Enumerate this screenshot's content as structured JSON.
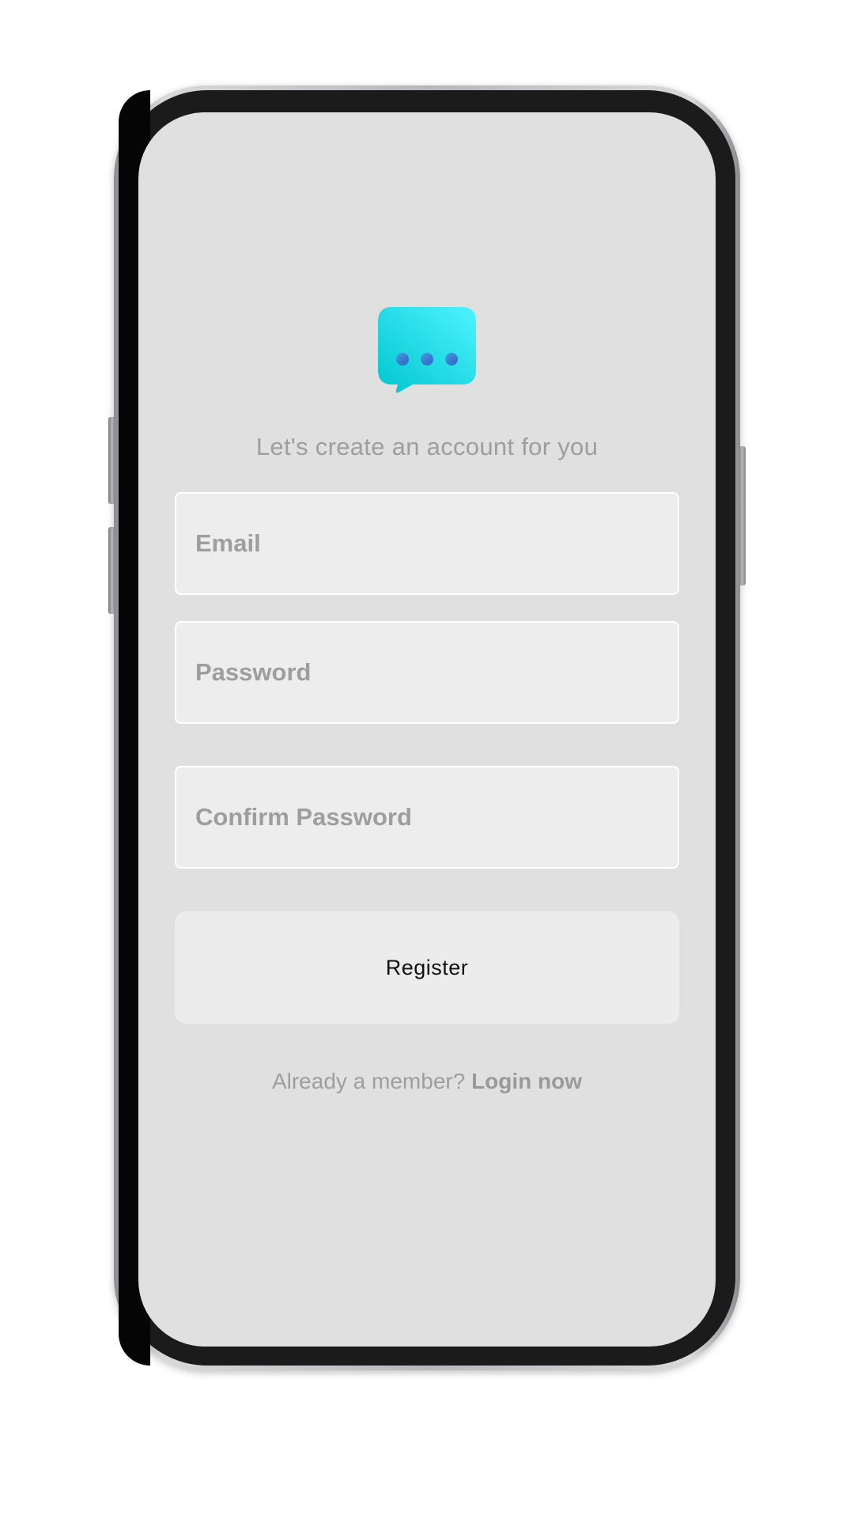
{
  "app": {
    "subtitle": "Let's create an account for you"
  },
  "form": {
    "email_placeholder": "Email",
    "password_placeholder": "Password",
    "confirm_password_placeholder": "Confirm Password",
    "register_label": "Register"
  },
  "footer": {
    "prompt": "Already a member?",
    "login_link": "Login now"
  },
  "icons": {
    "logo": "chat-bubble-icon"
  },
  "colors": {
    "screen_background": "#e0e0e0",
    "field_background": "#ededed",
    "muted_text": "#9e9e9e",
    "logo_gradient_start": "#00c6cf",
    "logo_gradient_end": "#4ef3ff",
    "logo_dots": "#3a7bd5"
  }
}
